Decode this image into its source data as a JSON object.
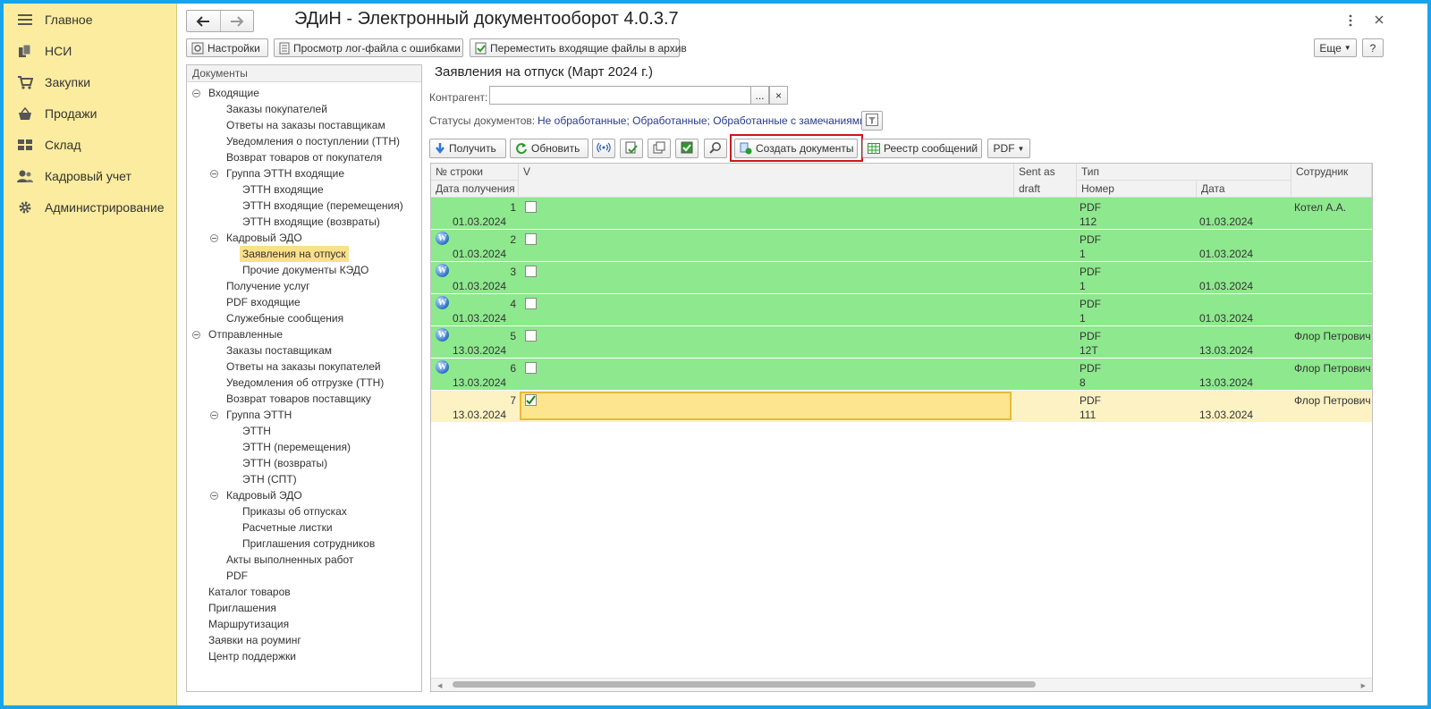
{
  "sidebar": {
    "items": [
      {
        "label": "Главное",
        "icon": "menu-lines-icon"
      },
      {
        "label": "НСИ",
        "icon": "books-icon"
      },
      {
        "label": "Закупки",
        "icon": "cart-icon"
      },
      {
        "label": "Продажи",
        "icon": "basket-icon"
      },
      {
        "label": "Склад",
        "icon": "warehouse-icon"
      },
      {
        "label": "Кадровый учет",
        "icon": "people-icon"
      },
      {
        "label": "Администрирование",
        "icon": "gear-icon"
      }
    ]
  },
  "window": {
    "title": "ЭДиН - Электронный документооборот 4.0.3.7",
    "more_label": "Еще",
    "help_label": "?"
  },
  "toolbar": {
    "settings": "Настройки",
    "view_log": "Просмотр лог-файла с ошибками",
    "move_archive": "Переместить входящие файлы в архив"
  },
  "tree": {
    "header": "Документы",
    "nodes": [
      "Входящие",
      "Заказы покупателей",
      "Ответы на заказы поставщикам",
      "Уведомления о поступлении (ТТН)",
      "Возврат товаров от покупателя",
      "Группа ЭТТН входящие",
      "ЭТТН входящие",
      "ЭТТН входящие (перемещения)",
      "ЭТТН входящие (возвраты)",
      "Кадровый ЭДО",
      "Заявления на отпуск",
      "Прочие документы КЭДО",
      "Получение услуг",
      "PDF входящие",
      "Служебные сообщения",
      "Отправленные",
      "Заказы поставщикам",
      "Ответы на заказы покупателей",
      "Уведомления об отгрузке (ТТН)",
      "Возврат товаров поставщику",
      "Группа ЭТТН",
      "ЭТТН",
      "ЭТТН (перемещения)",
      "ЭТТН (возвраты)",
      "ЭТН (СПТ)",
      "Кадровый ЭДО",
      "Приказы об отпусках",
      "Расчетные листки",
      "Приглашения сотрудников",
      "Акты выполненных работ",
      "PDF",
      "Каталог товаров",
      "Приглашения",
      "Маршрутизация",
      "Заявки на роуминг",
      "Центр поддержки"
    ]
  },
  "panel": {
    "title": "Заявления на отпуск (Март 2024 г.)",
    "counterparty_label": "Контрагент:",
    "counterparty_value": "",
    "ellipsis": "...",
    "clear": "×",
    "statuses_label": "Статусы документов:",
    "statuses_value": "Не обработанные; Обработанные; Обработанные с замечаниями;"
  },
  "actions": {
    "receive": "Получить",
    "refresh": "Обновить",
    "create_docs": "Создать документы",
    "registry": "Реестр сообщений",
    "pdf": "PDF"
  },
  "grid": {
    "headers": {
      "row_no": "№ строки",
      "received": "Дата получения",
      "v": "V",
      "sent_draft": "Sent as draft",
      "type": "Тип",
      "number": "Номер",
      "date": "Дата",
      "employee": "Сотрудник"
    },
    "rows": [
      {
        "no": "1",
        "received": "01.03.2024",
        "icon": false,
        "checked": false,
        "type": "PDF",
        "number": "112",
        "date": "01.03.2024",
        "employee": "Котел А.А.",
        "status": "green"
      },
      {
        "no": "2",
        "received": "01.03.2024",
        "icon": true,
        "checked": false,
        "type": "PDF",
        "number": "1",
        "date": "01.03.2024",
        "employee": "",
        "status": "green"
      },
      {
        "no": "3",
        "received": "01.03.2024",
        "icon": true,
        "checked": false,
        "type": "PDF",
        "number": "1",
        "date": "01.03.2024",
        "employee": "",
        "status": "green"
      },
      {
        "no": "4",
        "received": "01.03.2024",
        "icon": true,
        "checked": false,
        "type": "PDF",
        "number": "1",
        "date": "01.03.2024",
        "employee": "",
        "status": "green"
      },
      {
        "no": "5",
        "received": "13.03.2024",
        "icon": true,
        "checked": false,
        "type": "PDF",
        "number": "12Т",
        "date": "13.03.2024",
        "employee": "Флор Петрович",
        "status": "green"
      },
      {
        "no": "6",
        "received": "13.03.2024",
        "icon": true,
        "checked": false,
        "type": "PDF",
        "number": "8",
        "date": "13.03.2024",
        "employee": "Флор Петрович",
        "status": "green"
      },
      {
        "no": "7",
        "received": "13.03.2024",
        "icon": false,
        "checked": true,
        "type": "PDF",
        "number": "111",
        "date": "13.03.2024",
        "employee": "Флор Петрович",
        "status": "selected"
      }
    ]
  },
  "colors": {
    "frame": "#1aa3e8",
    "sidebar": "#fbec9f",
    "row_green": "#8ee88e",
    "row_selected": "#fdf2c4",
    "highlight_box": "#d0151d"
  }
}
